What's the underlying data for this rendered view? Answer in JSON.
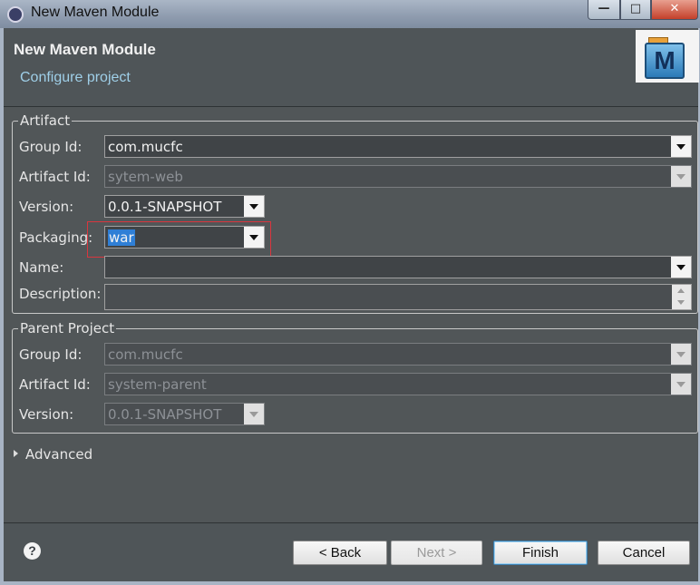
{
  "window": {
    "title": "New Maven Module",
    "controls": {
      "minimize": "—",
      "maximize": "□",
      "close": "✕"
    }
  },
  "header": {
    "heading": "New Maven Module",
    "subheading": "Configure project",
    "logo_letter": "M"
  },
  "artifact": {
    "legend": "Artifact",
    "group_id": {
      "label": "Group Id:",
      "value": "com.mucfc"
    },
    "artifact_id": {
      "label": "Artifact Id:",
      "value": "sytem-web"
    },
    "version": {
      "label": "Version:",
      "value": "0.0.1-SNAPSHOT"
    },
    "packaging": {
      "label": "Packaging:",
      "value": "war"
    },
    "name": {
      "label": "Name:",
      "value": ""
    },
    "description": {
      "label": "Description:",
      "value": ""
    }
  },
  "parent": {
    "legend": "Parent Project",
    "group_id": {
      "label": "Group Id:",
      "value": "com.mucfc"
    },
    "artifact_id": {
      "label": "Artifact Id:",
      "value": "system-parent"
    },
    "version": {
      "label": "Version:",
      "value": "0.0.1-SNAPSHOT"
    }
  },
  "advanced": {
    "label": "Advanced",
    "expanded": false
  },
  "buttons": {
    "help": "?",
    "back": "< Back",
    "next": "Next >",
    "finish": "Finish",
    "cancel": "Cancel"
  },
  "colors": {
    "background": "#515658",
    "highlight_box": "#d9363e",
    "selection": "#2f7fd6",
    "subheading": "#9fcfe8"
  }
}
